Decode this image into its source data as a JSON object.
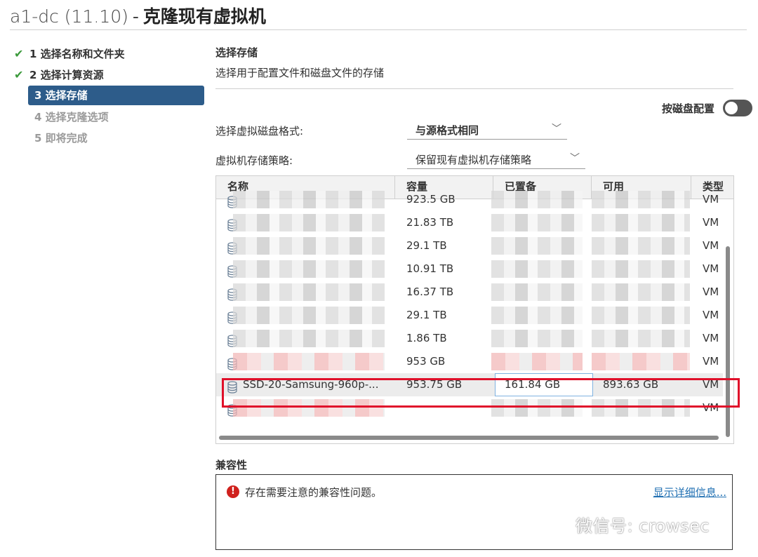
{
  "header": {
    "vm_name": "a1-dc (11.10)",
    "separator": "-",
    "title": "克隆现有虚拟机"
  },
  "steps": [
    {
      "label": "1 选择名称和文件夹",
      "state": "done"
    },
    {
      "label": "2 选择计算资源",
      "state": "done"
    },
    {
      "label": "3 选择存储",
      "state": "active"
    },
    {
      "label": "4 选择克隆选项",
      "state": "pending"
    },
    {
      "label": "5 即将完成",
      "state": "pending"
    }
  ],
  "content": {
    "title": "选择存储",
    "subtitle": "选择用于配置文件和磁盘文件的存储",
    "per_disk_label": "按磁盘配置",
    "per_disk_enabled": false,
    "disk_format_label": "选择虚拟磁盘格式:",
    "disk_format_value": "与源格式相同",
    "policy_label": "虚拟机存储策略:",
    "policy_value": "保留现有虚拟机存储策略"
  },
  "grid": {
    "columns": [
      "名称",
      "容量",
      "已置备",
      "可用",
      "类型"
    ],
    "rows": [
      {
        "name": "",
        "capacity": "923.5 GB",
        "provisioned": "",
        "free": "",
        "type": "VM"
      },
      {
        "name": "",
        "capacity": "21.83 TB",
        "provisioned": "",
        "free": "",
        "type": "VM"
      },
      {
        "name": "",
        "capacity": "29.1 TB",
        "provisioned": "",
        "free": "",
        "type": "VM"
      },
      {
        "name": "",
        "capacity": "10.91 TB",
        "provisioned": "",
        "free": "",
        "type": "VM"
      },
      {
        "name": "",
        "capacity": "16.37 TB",
        "provisioned": "",
        "free": "",
        "type": "VM"
      },
      {
        "name": "",
        "capacity": "29.1 TB",
        "provisioned": "",
        "free": "",
        "type": "VM"
      },
      {
        "name": "",
        "capacity": "1.86 TB",
        "provisioned": "",
        "free": "",
        "type": "VM"
      },
      {
        "name": "",
        "capacity": "953 GB",
        "provisioned": "",
        "free": "",
        "type": "VM"
      },
      {
        "name": "SSD-20-Samsung-960p-...",
        "capacity": "953.75 GB",
        "provisioned": "161.84 GB",
        "free": "893.63 GB",
        "type": "VM",
        "selected": true
      },
      {
        "name": "",
        "capacity": "",
        "provisioned": "",
        "free": "",
        "type": "VM"
      }
    ]
  },
  "compat": {
    "label": "兼容性",
    "message": "存在需要注意的兼容性问题。",
    "details_link": "显示详细信息...",
    "icon": "error-icon"
  },
  "watermark": "微信号: crowsec",
  "colors": {
    "accent": "#2d5c8a",
    "check": "#3c9a3c",
    "error": "#d0211d",
    "highlight_box": "#e0102a",
    "link": "#1f6fb2"
  }
}
